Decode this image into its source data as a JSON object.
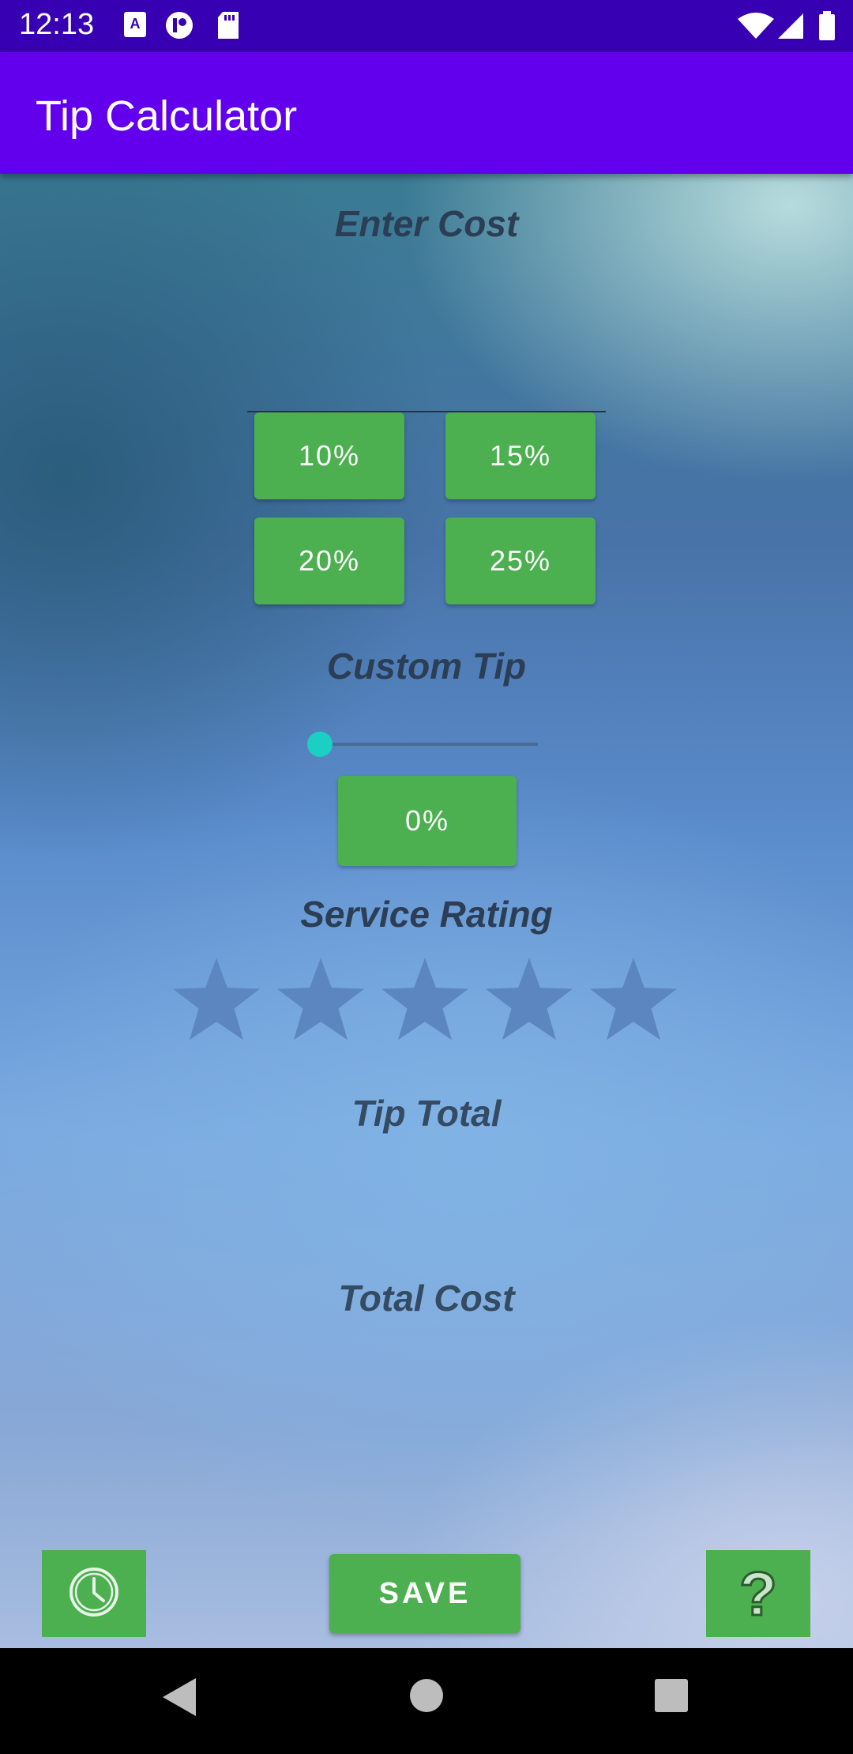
{
  "status_bar": {
    "time": "12:13"
  },
  "app_bar": {
    "title": "Tip Calculator"
  },
  "cost": {
    "label": "Enter Cost",
    "value": "",
    "placeholder": ""
  },
  "presets": [
    {
      "label": "10%"
    },
    {
      "label": "15%"
    },
    {
      "label": "20%"
    },
    {
      "label": "25%"
    }
  ],
  "custom_tip": {
    "label": "Custom Tip",
    "slider_value": 0,
    "button_label": "0%"
  },
  "rating": {
    "label": "Service Rating",
    "max_stars": 5,
    "value": 0
  },
  "tip_total": {
    "label": "Tip Total"
  },
  "total_cost": {
    "label": "Total Cost"
  },
  "footer": {
    "save_label": "SAVE",
    "help_glyph": "?"
  },
  "icons": {
    "history": "clock-icon",
    "help": "question-mark-icon",
    "back": "back-triangle-icon",
    "home": "home-circle-icon",
    "recents": "recents-square-icon"
  },
  "colors": {
    "status_bar": "#3700b3",
    "app_bar": "#6200ee",
    "button": "#4caf50",
    "slider_thumb": "#1ad0c4"
  }
}
